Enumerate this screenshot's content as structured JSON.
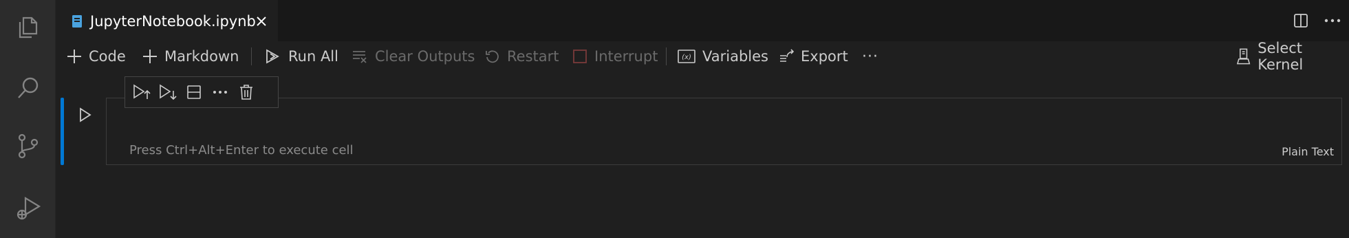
{
  "activity_bar": {
    "items": [
      {
        "icon": "explorer-icon"
      },
      {
        "icon": "search-icon"
      },
      {
        "icon": "source-control-icon"
      },
      {
        "icon": "run-debug-icon"
      }
    ]
  },
  "tab": {
    "title": "JupyterNotebook.ipynb",
    "file_icon": "notebook-file-icon",
    "close_icon": "close-icon",
    "accent_color": "#4aa3df"
  },
  "editor_actions": {
    "split_icon": "split-editor-icon",
    "more_icon": "more-actions-icon"
  },
  "toolbar": {
    "code_label": "Code",
    "markdown_label": "Markdown",
    "run_all_label": "Run All",
    "clear_outputs_label": "Clear Outputs",
    "restart_label": "Restart",
    "interrupt_label": "Interrupt",
    "variables_label": "Variables",
    "export_label": "Export",
    "more_label": "···",
    "select_kernel_label": "Select Kernel"
  },
  "cell": {
    "placeholder": "Press Ctrl+Alt+Enter to execute cell",
    "language": "Plain Text",
    "focus_color": "#0078d4",
    "toolbar_icons": [
      "run-above-icon",
      "run-below-icon",
      "split-cell-icon",
      "more-icon",
      "delete-icon"
    ]
  }
}
